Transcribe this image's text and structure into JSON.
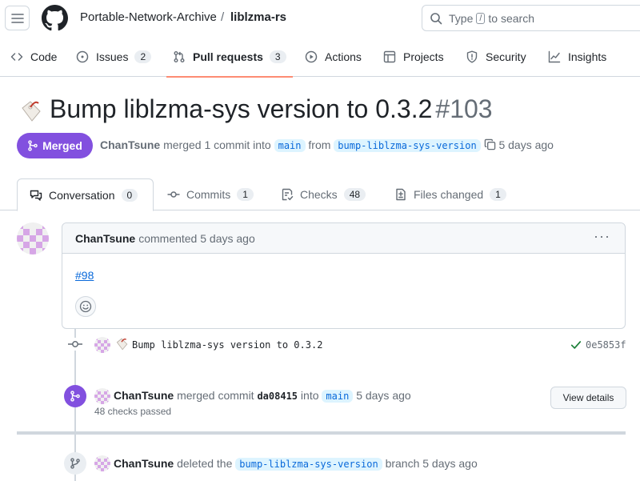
{
  "header": {
    "owner": "Portable-Network-Archive",
    "separator": "/",
    "repo": "liblzma-rs",
    "search_prefix": "Type",
    "search_key": "/",
    "search_suffix": "to search"
  },
  "repo_nav": {
    "code": "Code",
    "issues": "Issues",
    "issues_count": "2",
    "pull_requests": "Pull requests",
    "pull_requests_count": "3",
    "actions": "Actions",
    "projects": "Projects",
    "security": "Security",
    "insights": "Insights"
  },
  "pr": {
    "title": "Bump liblzma-sys version to 0.3.2",
    "number": "#103",
    "state": "Merged",
    "author": "ChanTsune",
    "meta_text": "merged 1 commit into",
    "base_branch": "main",
    "from_text": "from",
    "head_branch": "bump-liblzma-sys-version",
    "time": "5 days ago"
  },
  "tabs": [
    {
      "label": "Conversation",
      "count": "0"
    },
    {
      "label": "Commits",
      "count": "1"
    },
    {
      "label": "Checks",
      "count": "48"
    },
    {
      "label": "Files changed",
      "count": "1"
    }
  ],
  "comment": {
    "author": "ChanTsune",
    "action": "commented 5 days ago",
    "body_link": "#98",
    "menu": "···"
  },
  "timeline": {
    "commit_message": "Bump liblzma-sys version to 0.3.2",
    "commit_sha": "0e5853f",
    "merge": {
      "author": "ChanTsune",
      "action": "merged commit",
      "sha": "da08415",
      "into": "into",
      "branch": "main",
      "time": "5 days ago",
      "checks": "48 checks passed",
      "button": "View details"
    },
    "delete": {
      "author": "ChanTsune",
      "action": "deleted the",
      "branch": "bump-liblzma-sys-version",
      "suffix": "branch 5 days ago"
    }
  },
  "colors": {
    "merged": "#8250df",
    "link": "#0969da",
    "success": "#1a7f37",
    "active_underline": "#fd8c73"
  }
}
